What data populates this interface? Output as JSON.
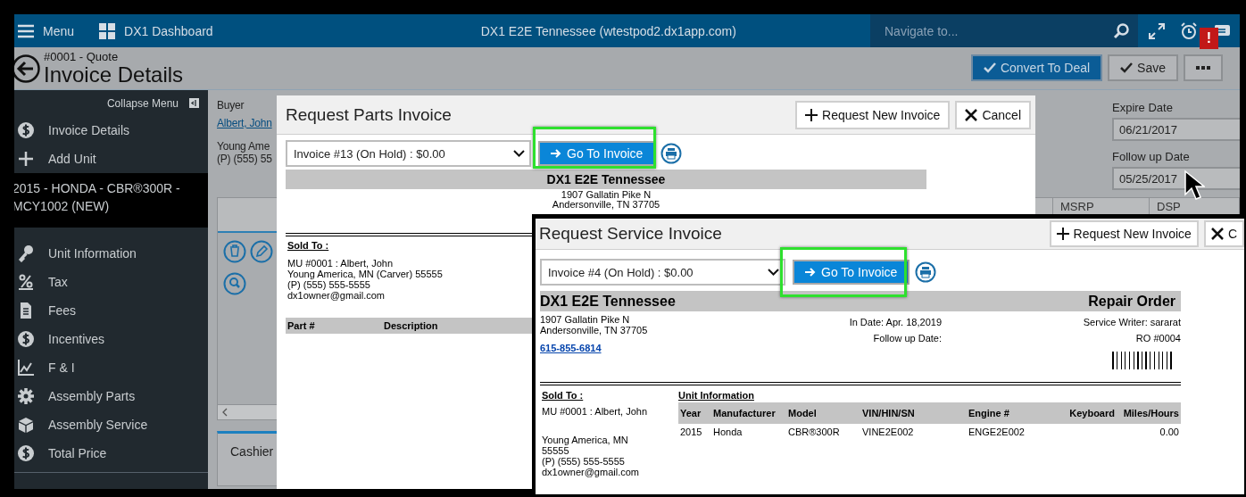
{
  "header": {
    "menu_label": "Menu",
    "dashboard_label": "DX1 Dashboard",
    "title": "DX1 E2E Tennessee (wtestpod2.dx1app.com)",
    "search": {
      "placeholder": "Navigate to..."
    },
    "alert_badge": "!"
  },
  "page": {
    "subtitle": "#0001 - Quote",
    "title": "Invoice Details",
    "actions": [
      {
        "kind": "primary",
        "label": "Convert To Deal"
      },
      {
        "kind": "check",
        "label": "Save"
      },
      {
        "kind": "more"
      }
    ]
  },
  "sidebar": {
    "collapse_label": "Collapse Menu",
    "items": [
      {
        "kind": "link",
        "label": "Invoice Details"
      },
      {
        "kind": "link",
        "label": "Add Unit"
      },
      {
        "kind": "unit",
        "label": "2015 - HONDA - CBR®300R - MCY1002 (NEW)"
      },
      {
        "kind": "link",
        "label": "Unit Information"
      },
      {
        "kind": "link",
        "label": "Tax"
      },
      {
        "kind": "link",
        "label": "Fees"
      },
      {
        "kind": "link",
        "label": "Incentives"
      },
      {
        "kind": "link",
        "label": "F & I"
      },
      {
        "kind": "link",
        "label": "Assembly Parts"
      },
      {
        "kind": "link",
        "label": "Assembly Service"
      },
      {
        "kind": "link",
        "label": "Total Price"
      }
    ]
  },
  "buyer": {
    "label": "Buyer",
    "name": "Albert, John",
    "lines": [
      "Young Ame",
      "(P) (555) 55"
    ]
  },
  "dates": [
    {
      "label": "Expire Date",
      "value": "06/21/2017"
    },
    {
      "label": "Follow up Date",
      "value": "05/25/2017"
    }
  ],
  "grid": {
    "columns": [
      "MSRP",
      "DSP"
    ]
  },
  "bottom_tabs": [
    {
      "label": "Cashier",
      "selected": true
    }
  ],
  "parts_dialog": {
    "title": "Request Parts Invoice",
    "buttons": [
      {
        "kind": "add",
        "label": "Request New Invoice"
      },
      {
        "kind": "cancel",
        "label": "Cancel"
      }
    ],
    "invoice_select": "Invoice #13 (On Hold) : $0.00",
    "go_button": "Go To Invoice",
    "document": {
      "dealer": "DX1 E2E Tennessee",
      "address": [
        "1907 Gallatin Pike N",
        "Andersonville, TN 37705"
      ],
      "sold_to_label": "Sold To :",
      "sold_to": [
        "MU #0001 : Albert, John",
        "Young America, MN (Carver) 55555",
        "(P) (555) 555-5555",
        "dx1owner@gmail.com"
      ],
      "columns": [
        "Part #",
        "Description"
      ]
    }
  },
  "service_dialog": {
    "title": "Request Service Invoice",
    "buttons": [
      {
        "kind": "add",
        "label": "Request New Invoice"
      },
      {
        "kind": "cancel",
        "label": "C"
      }
    ],
    "invoice_select": "Invoice #4 (On Hold) : $0.00",
    "go_button": "Go To Invoice",
    "document": {
      "dealer": "DX1 E2E Tennessee",
      "doc_type": "Repair Order",
      "address": [
        "1907 Gallatin Pike N",
        "Andersonville, TN 37705"
      ],
      "phone": "615-855-6814",
      "dates": [
        "In Date: Apr. 18,2019",
        "Follow up Date:"
      ],
      "service_writer": "Service Writer: sararat",
      "ro_number": "RO #0004",
      "sold_to_label": "Sold To :",
      "sold_to": [
        "MU #0001 : Albert, John",
        "Young America, MN",
        "55555",
        "(P) (555) 555-5555",
        "dx1owner@gmail.com"
      ],
      "unit_label": "Unit Information",
      "unit_table": {
        "columns": [
          "Year",
          "Manufacturer",
          "Model",
          "VIN/HIN/SN",
          "Engine #",
          "Keyboard",
          "Miles/Hours"
        ],
        "rows": [
          [
            "2015",
            "Honda",
            "CBR®300R",
            "VINE2E002",
            "ENGE2E002",
            null,
            "0.00"
          ]
        ]
      }
    }
  }
}
